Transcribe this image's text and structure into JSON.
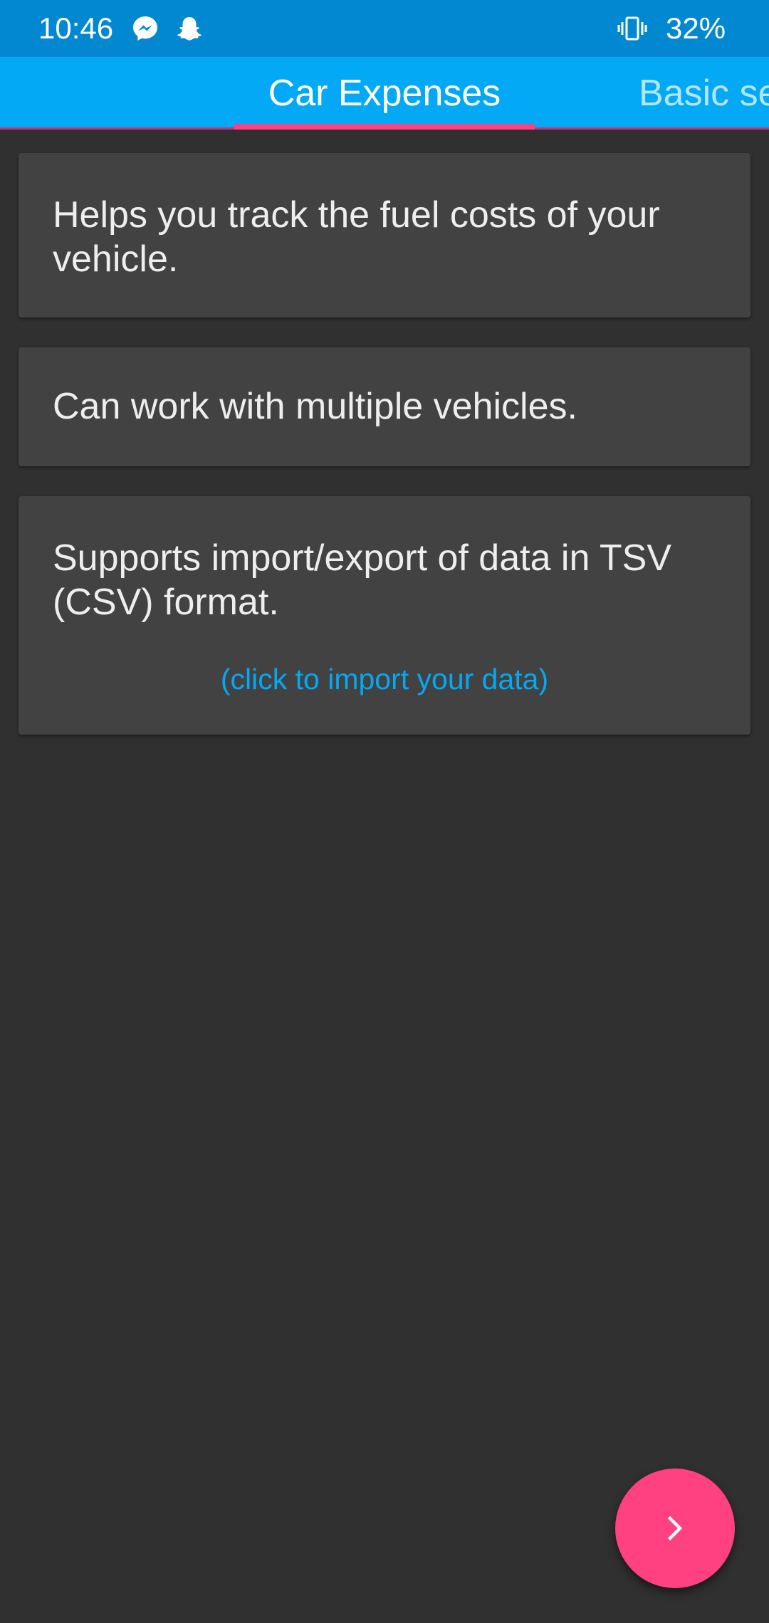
{
  "status_bar": {
    "time": "10:46",
    "battery": "32%",
    "icons": [
      "messenger-icon",
      "snapchat-icon",
      "vibrate-icon"
    ],
    "background": "#0288d1"
  },
  "tabs": {
    "items": [
      {
        "label": "Car Expenses",
        "selected": true
      },
      {
        "label": "Basic se",
        "selected": false
      }
    ],
    "background": "#03a9f4",
    "indicator_color": "#ff4081"
  },
  "cards": [
    {
      "text": "Helps you track the fuel costs of your vehicle."
    },
    {
      "text": "Can work with multiple vehicles."
    },
    {
      "text": "Supports import/export of data in TSV (CSV) format.",
      "link": "(click to import your data)"
    }
  ],
  "fab": {
    "icon": "chevron-right-icon",
    "color": "#ff4081"
  },
  "colors": {
    "background": "#303030",
    "card": "#424242",
    "link": "#03a9f4"
  }
}
